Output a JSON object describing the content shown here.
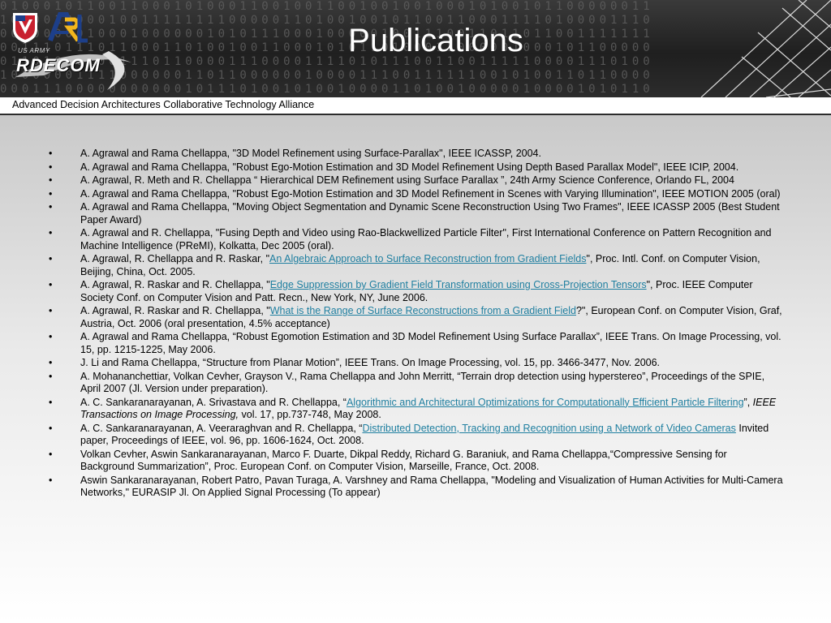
{
  "header": {
    "title": "Publications",
    "logo_arl": "ARL",
    "logo_usarmy": "US ARMY",
    "logo_rdecom": "RDECOM"
  },
  "subtitle": "Advanced Decision Architectures Collaborative Technology Alliance",
  "bullet": "•",
  "colors": {
    "link": "#1f7fa0",
    "banner": "#262626",
    "title": "#ffffff"
  },
  "publications": [
    {
      "segments": [
        {
          "text": "A. Agrawal and Rama Chellappa, \"3D Model Refinement using Surface-Parallax\", IEEE ICASSP, 2004."
        }
      ]
    },
    {
      "segments": [
        {
          "text": "A. Agrawal and Rama Chellappa, \"Robust Ego-Motion Estimation and 3D Model Refinement Using Depth Based Parallax Model\", IEEE ICIP, 2004."
        }
      ]
    },
    {
      "segments": [
        {
          "text": "A. Agrawal, R. Meth and R. Chellappa “ Hierarchical DEM Refinement using Surface Parallax ”, 24th Army Science Conference, Orlando FL, 2004"
        }
      ]
    },
    {
      "segments": [
        {
          "text": "A. Agrawal and Rama Chellappa, \"Robust Ego-Motion Estimation and 3D Model Refinement in Scenes with Varying Illumination\", IEEE MOTION 2005 (oral)"
        }
      ]
    },
    {
      "segments": [
        {
          "text": "A. Agrawal and Rama Chellappa, \"Moving Object Segmentation and Dynamic Scene Reconstruction Using Two Frames\", IEEE ICASSP 2005 (Best Student Paper Award)"
        }
      ]
    },
    {
      "segments": [
        {
          "text": "A. Agrawal and R. Chellappa, \"Fusing Depth and Video using Rao-Blackwellized Particle Filter\", First International Conference on Pattern Recognition and Machine Intelligence (PReMI), Kolkatta, Dec 2005 (oral)."
        }
      ]
    },
    {
      "segments": [
        {
          "text": "A. Agrawal, R. Chellappa and R. Raskar, \""
        },
        {
          "text": "An Algebraic Approach to Surface Reconstruction from Gradient Fields",
          "link": true
        },
        {
          "text": "\",  Proc. Intl. Conf. on Computer Vision, Beijing, China, Oct. 2005."
        }
      ]
    },
    {
      "segments": [
        {
          "text": "A. Agrawal, R. Raskar and R. Chellappa, \""
        },
        {
          "text": "Edge Suppression by Gradient Field Transformation using Cross-Projection Tensors",
          "link": true
        },
        {
          "text": "\", Proc. IEEE Computer Society Conf. on Computer Vision and Patt. Recn., New York, NY, June 2006."
        }
      ]
    },
    {
      "segments": [
        {
          "text": "A. Agrawal, R. Raskar and R. Chellappa, \""
        },
        {
          "text": "What is the Range of Surface Reconstructions from a Gradient Field",
          "link": true
        },
        {
          "text": "?\", European Conf. on Computer Vision, Graf, Austria, Oct. 2006  (oral presentation, 4.5% acceptance)"
        }
      ]
    },
    {
      "segments": [
        {
          "text": "A. Agrawal and Rama Chellappa, “Robust Egomotion Estimation and 3D Model Refinement Using Surface Parallax”, IEEE Trans. On Image Processing, vol. 15, pp. 1215-1225, May  2006."
        }
      ]
    },
    {
      "segments": [
        {
          "text": "J. Li and Rama Chellappa, “Structure from Planar Motion”, IEEE Trans. On Image Processing, vol. 15, pp. 3466-3477, Nov. 2006."
        }
      ]
    },
    {
      "segments": [
        {
          "text": "A. Mohananchettiar, Volkan Cevher, Grayson V., Rama Chellappa and John Merritt, “Terrain drop detection using hyperstereo”, Proceedings of the SPIE, April 2007 (Jl. Version under preparation)."
        }
      ]
    },
    {
      "segments": [
        {
          "text": "A. C. Sankaranarayanan, A. Srivastava and R. Chellappa, “"
        },
        {
          "text": "Algorithmic and Architectural Optimizations for Computationally Efficient Particle Filtering",
          "link": true
        },
        {
          "text": "”,  "
        },
        {
          "text": "IEEE Transactions on Image Processing,",
          "italic": true
        },
        {
          "text": " vol. 17, pp.737-748, May 2008."
        }
      ]
    },
    {
      "segments": [
        {
          "text": "A. C. Sankaranarayanan, A. Veeraraghvan and R. Chellappa, “"
        },
        {
          "text": "Distributed Detection, Tracking and Recognition using a Network of Video Cameras",
          "link": true
        },
        {
          "text": " Invited paper, Proceedings of IEEE, vol. 96, pp. 1606-1624, Oct. 2008."
        }
      ]
    },
    {
      "segments": [
        {
          "text": "Volkan Cevher, Aswin Sankaranarayanan, Marco F. Duarte, Dikpal Reddy, Richard G. Baraniuk, and Rama Chellappa,“Compressive Sensing for Background Summarization”, Proc. European Conf. on Computer Vision, Marseille, France, Oct. 2008."
        }
      ]
    },
    {
      "segments": [
        {
          "text": "Aswin Sankaranarayanan, Robert Patro, Pavan Turaga, A. Varshney and Rama Chellappa, \"Modeling and Visualization of Human Activities for Multi-Camera Networks,\" EURASIP Jl. On Applied Signal Processing (To appear)"
        }
      ]
    }
  ]
}
